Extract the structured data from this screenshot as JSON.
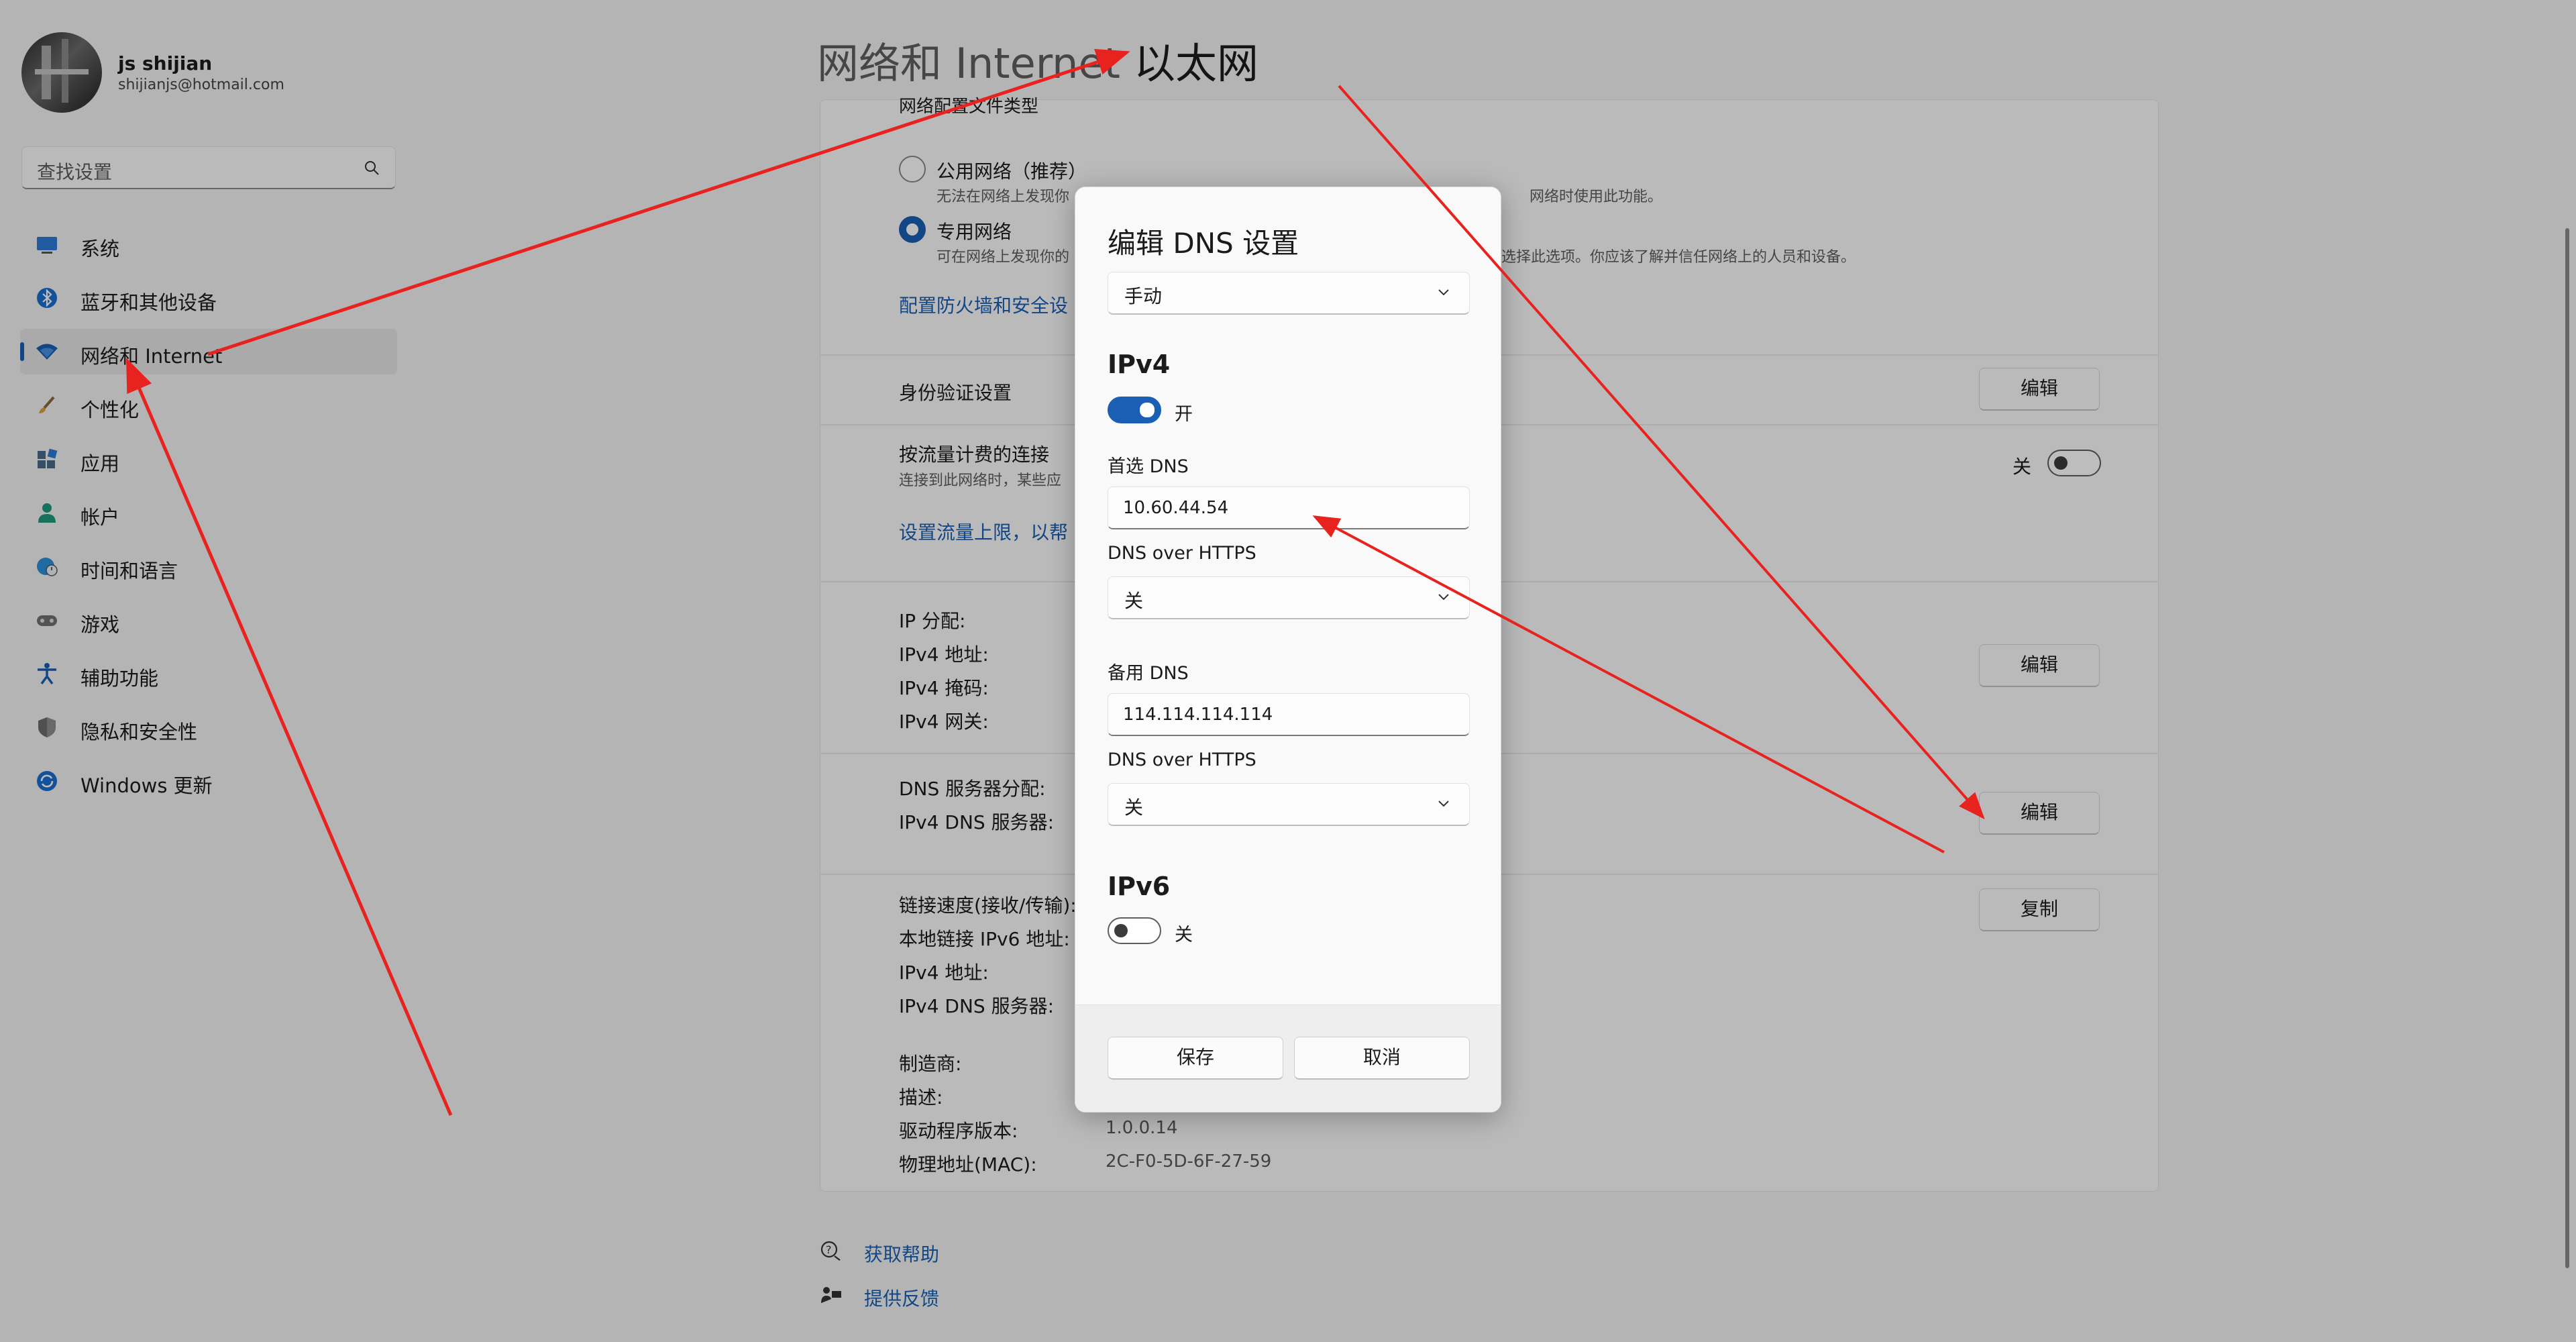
{
  "user": {
    "name": "js shijian",
    "email": "shijianjs@hotmail.com"
  },
  "search": {
    "placeholder": "查找设置"
  },
  "sidebar": {
    "items": [
      {
        "label": "系统",
        "icon": "monitor-icon"
      },
      {
        "label": "蓝牙和其他设备",
        "icon": "bluetooth-icon"
      },
      {
        "label": "网络和 Internet",
        "icon": "wifi-icon",
        "active": true
      },
      {
        "label": "个性化",
        "icon": "brush-icon"
      },
      {
        "label": "应用",
        "icon": "apps-icon"
      },
      {
        "label": "帐户",
        "icon": "person-icon"
      },
      {
        "label": "时间和语言",
        "icon": "globe-clock-icon"
      },
      {
        "label": "游戏",
        "icon": "gamepad-icon"
      },
      {
        "label": "辅助功能",
        "icon": "accessibility-icon"
      },
      {
        "label": "隐私和安全性",
        "icon": "shield-icon"
      },
      {
        "label": "Windows 更新",
        "icon": "update-icon"
      }
    ]
  },
  "header": {
    "parent": "网络和 Internet",
    "separator": "›",
    "current": "以太网"
  },
  "content": {
    "profile_type_label": "网络配置文件类型",
    "public_label": "公用网络（推荐）",
    "public_desc_left": "无法在网络上发现你",
    "public_desc_right": "网络时使用此功能。",
    "private_label": "专用网络",
    "private_desc_left": "可在网络上发现你的",
    "private_desc_right": "选择此选项。你应该了解并信任网络上的人员和设备。",
    "firewall_link": "配置防火墙和安全设",
    "auth_label": "身份验证设置",
    "auth_button": "编辑",
    "metered_label": "按流量计费的连接",
    "metered_desc": "连接到此网络时，某些应",
    "metered_state": "关",
    "data_limit_link": "设置流量上限，以帮",
    "ip_assign": "IP 分配:",
    "ipv4_addr": "IPv4 地址:",
    "ipv4_mask": "IPv4 掩码:",
    "ipv4_gateway": "IPv4 网关:",
    "ip_edit": "编辑",
    "dns_assign": "DNS 服务器分配:",
    "ipv4_dns": "IPv4 DNS 服务器:",
    "dns_edit": "编辑",
    "link_speed": "链接速度(接收/传输):",
    "ipv6_local": "本地链接 IPv6 地址:",
    "ipv4_addr2": "IPv4 地址:",
    "ipv4_dns2": "IPv4 DNS 服务器:",
    "copy_button": "复制",
    "manufacturer": "制造商:",
    "description": "描述:",
    "driver_version": "驱动程序版本:",
    "driver_version_value": "1.0.0.14",
    "mac": "物理地址(MAC):",
    "mac_value": "2C-F0-5D-6F-27-59"
  },
  "help": {
    "get_help": "获取帮助",
    "feedback": "提供反馈"
  },
  "dialog": {
    "title": "编辑 DNS 设置",
    "mode": "手动",
    "ipv4_title": "IPv4",
    "ipv4_state": "开",
    "preferred_label": "首选 DNS",
    "preferred_value": "10.60.44.54",
    "doh_label1": "DNS over HTTPS",
    "doh_value1": "关",
    "alternate_label": "备用 DNS",
    "alternate_value": "114.114.114.114",
    "doh_label2": "DNS over HTTPS",
    "doh_value2": "关",
    "ipv6_title": "IPv6",
    "ipv6_state": "关",
    "save": "保存",
    "cancel": "取消"
  },
  "colors": {
    "accent": "#1a5fb4",
    "annotation_arrow": "#e8231f"
  }
}
